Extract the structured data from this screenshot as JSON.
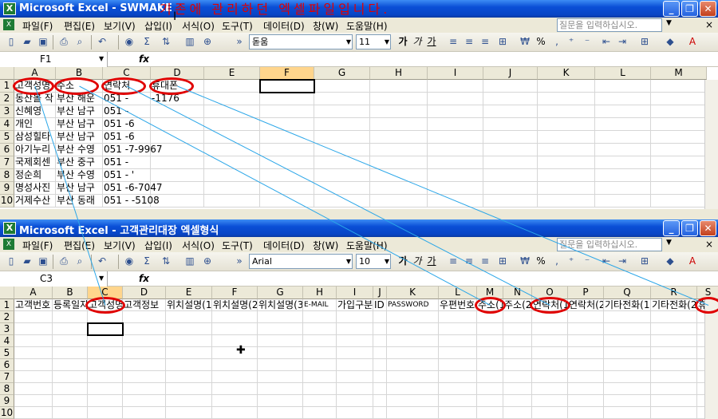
{
  "win1": {
    "title": "Microsoft Excel - SWMAKE",
    "annotation": "기존에 관리하던 엑셀파일입니다.",
    "menu": [
      "파일(F)",
      "편집(E)",
      "보기(V)",
      "삽입(I)",
      "서식(O)",
      "도구(T)",
      "데이터(D)",
      "창(W)",
      "도움말(H)"
    ],
    "help_placeholder": "질문을 입력하십시오.",
    "font": "돋움",
    "font_size": "11",
    "namebox": "F1",
    "columns": [
      "A",
      "B",
      "C",
      "D",
      "E",
      "F",
      "G",
      "H",
      "I",
      "J",
      "K",
      "L",
      "M"
    ],
    "rows": [
      "1",
      "2",
      "3",
      "4",
      "5",
      "6",
      "7",
      "8",
      "9",
      "10"
    ],
    "cells": [
      [
        "고객성명",
        "주소",
        "연락처",
        "휴대폰"
      ],
      [
        "동산볼 작",
        "부산 해운",
        "051 -",
        "-1176"
      ],
      [
        "신혜영",
        "부산 남구",
        "051 -",
        ""
      ],
      [
        "개인",
        "부산 남구",
        "051 -6",
        ""
      ],
      [
        "삼성힐타",
        "부산 남구",
        "051 -6",
        ""
      ],
      [
        "아기누리",
        "부산 수영",
        "051 -7-9967",
        ""
      ],
      [
        "국제회센",
        "부산 중구",
        "051 -",
        ""
      ],
      [
        "정순희",
        "부산 수영",
        "051 - '",
        ""
      ],
      [
        "명성사진",
        "부산 남구",
        "051 -6-7047",
        ""
      ],
      [
        "거제수산",
        "부산 동래",
        "051 - -5108",
        ""
      ]
    ]
  },
  "win2": {
    "title": "Microsoft Excel - 고객관리대장 엑셀형식",
    "menu": [
      "파일(F)",
      "편집(E)",
      "보기(V)",
      "삽입(I)",
      "서식(O)",
      "도구(T)",
      "데이터(D)",
      "창(W)",
      "도움말(H)"
    ],
    "help_placeholder": "질문을 입력하십시오.",
    "font": "Arial",
    "font_size": "10",
    "namebox": "C3",
    "columns": [
      "A",
      "B",
      "C",
      "D",
      "E",
      "F",
      "G",
      "H",
      "I",
      "J",
      "K",
      "L",
      "M",
      "N",
      "O",
      "P",
      "Q",
      "R",
      "S"
    ],
    "rows": [
      "1",
      "2",
      "3",
      "4",
      "5",
      "6",
      "7",
      "8",
      "9",
      "10"
    ],
    "headers": [
      "고객번호",
      "등록일자",
      "고객성명",
      "고객정보",
      "위치설명(1)",
      "위치설명(2)",
      "위치설명(3)",
      "E-MAIL",
      "가입구분",
      "ID",
      "PASSWORD",
      "우편번호",
      "주소(1)",
      "주소(2)",
      "연락처(1)",
      "연락처(2)",
      "기타전화(1)",
      "기타전화(2)",
      "휴대폰"
    ]
  },
  "toolbar_labels": {
    "zoom": "»",
    "sigma": "Σ",
    "percent": "%",
    "bold": "가",
    "italic": "가",
    "underline": "가"
  },
  "colors": {
    "title_bar": "#0a4fd6",
    "annotation": "#e00000",
    "connector": "#2aa6e8",
    "selected_header": "#ffd58c"
  }
}
